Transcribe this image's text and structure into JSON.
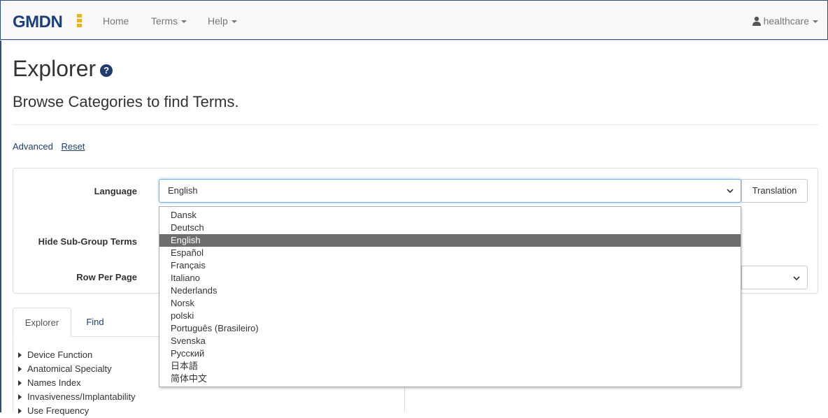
{
  "navbar": {
    "brand": "GMDN",
    "home": "Home",
    "terms": "Terms",
    "help": "Help",
    "user": "healthcare"
  },
  "page": {
    "title": "Explorer",
    "help_icon": "question-circle-icon",
    "subtitle": "Browse Categories to find Terms.",
    "advanced": "Advanced",
    "reset": "Reset"
  },
  "filters": {
    "language_label": "Language",
    "language_value": "English",
    "translation_button": "Translation",
    "hide_subgroup_label": "Hide Sub-Group Terms",
    "rows_per_page_label": "Row Per Page"
  },
  "language_options": [
    "Dansk",
    "Deutsch",
    "English",
    "Español",
    "Français",
    "Italiano",
    "Nederlands",
    "Norsk",
    "polski",
    "Português (Brasileiro)",
    "Svenska",
    "Русский",
    "日本語",
    "简体中文"
  ],
  "selected_option_index": 2,
  "tabs": {
    "explorer": "Explorer",
    "find": "Find"
  },
  "tree": [
    "Device Function",
    "Anatomical Specialty",
    "Names Index",
    "Invasiveness/Implantability",
    "Use Frequency"
  ],
  "colors": {
    "brand_blue": "#1b3f7a",
    "brand_accent": "#e9b31f",
    "selected_option_bg": "#6d6d6d"
  }
}
